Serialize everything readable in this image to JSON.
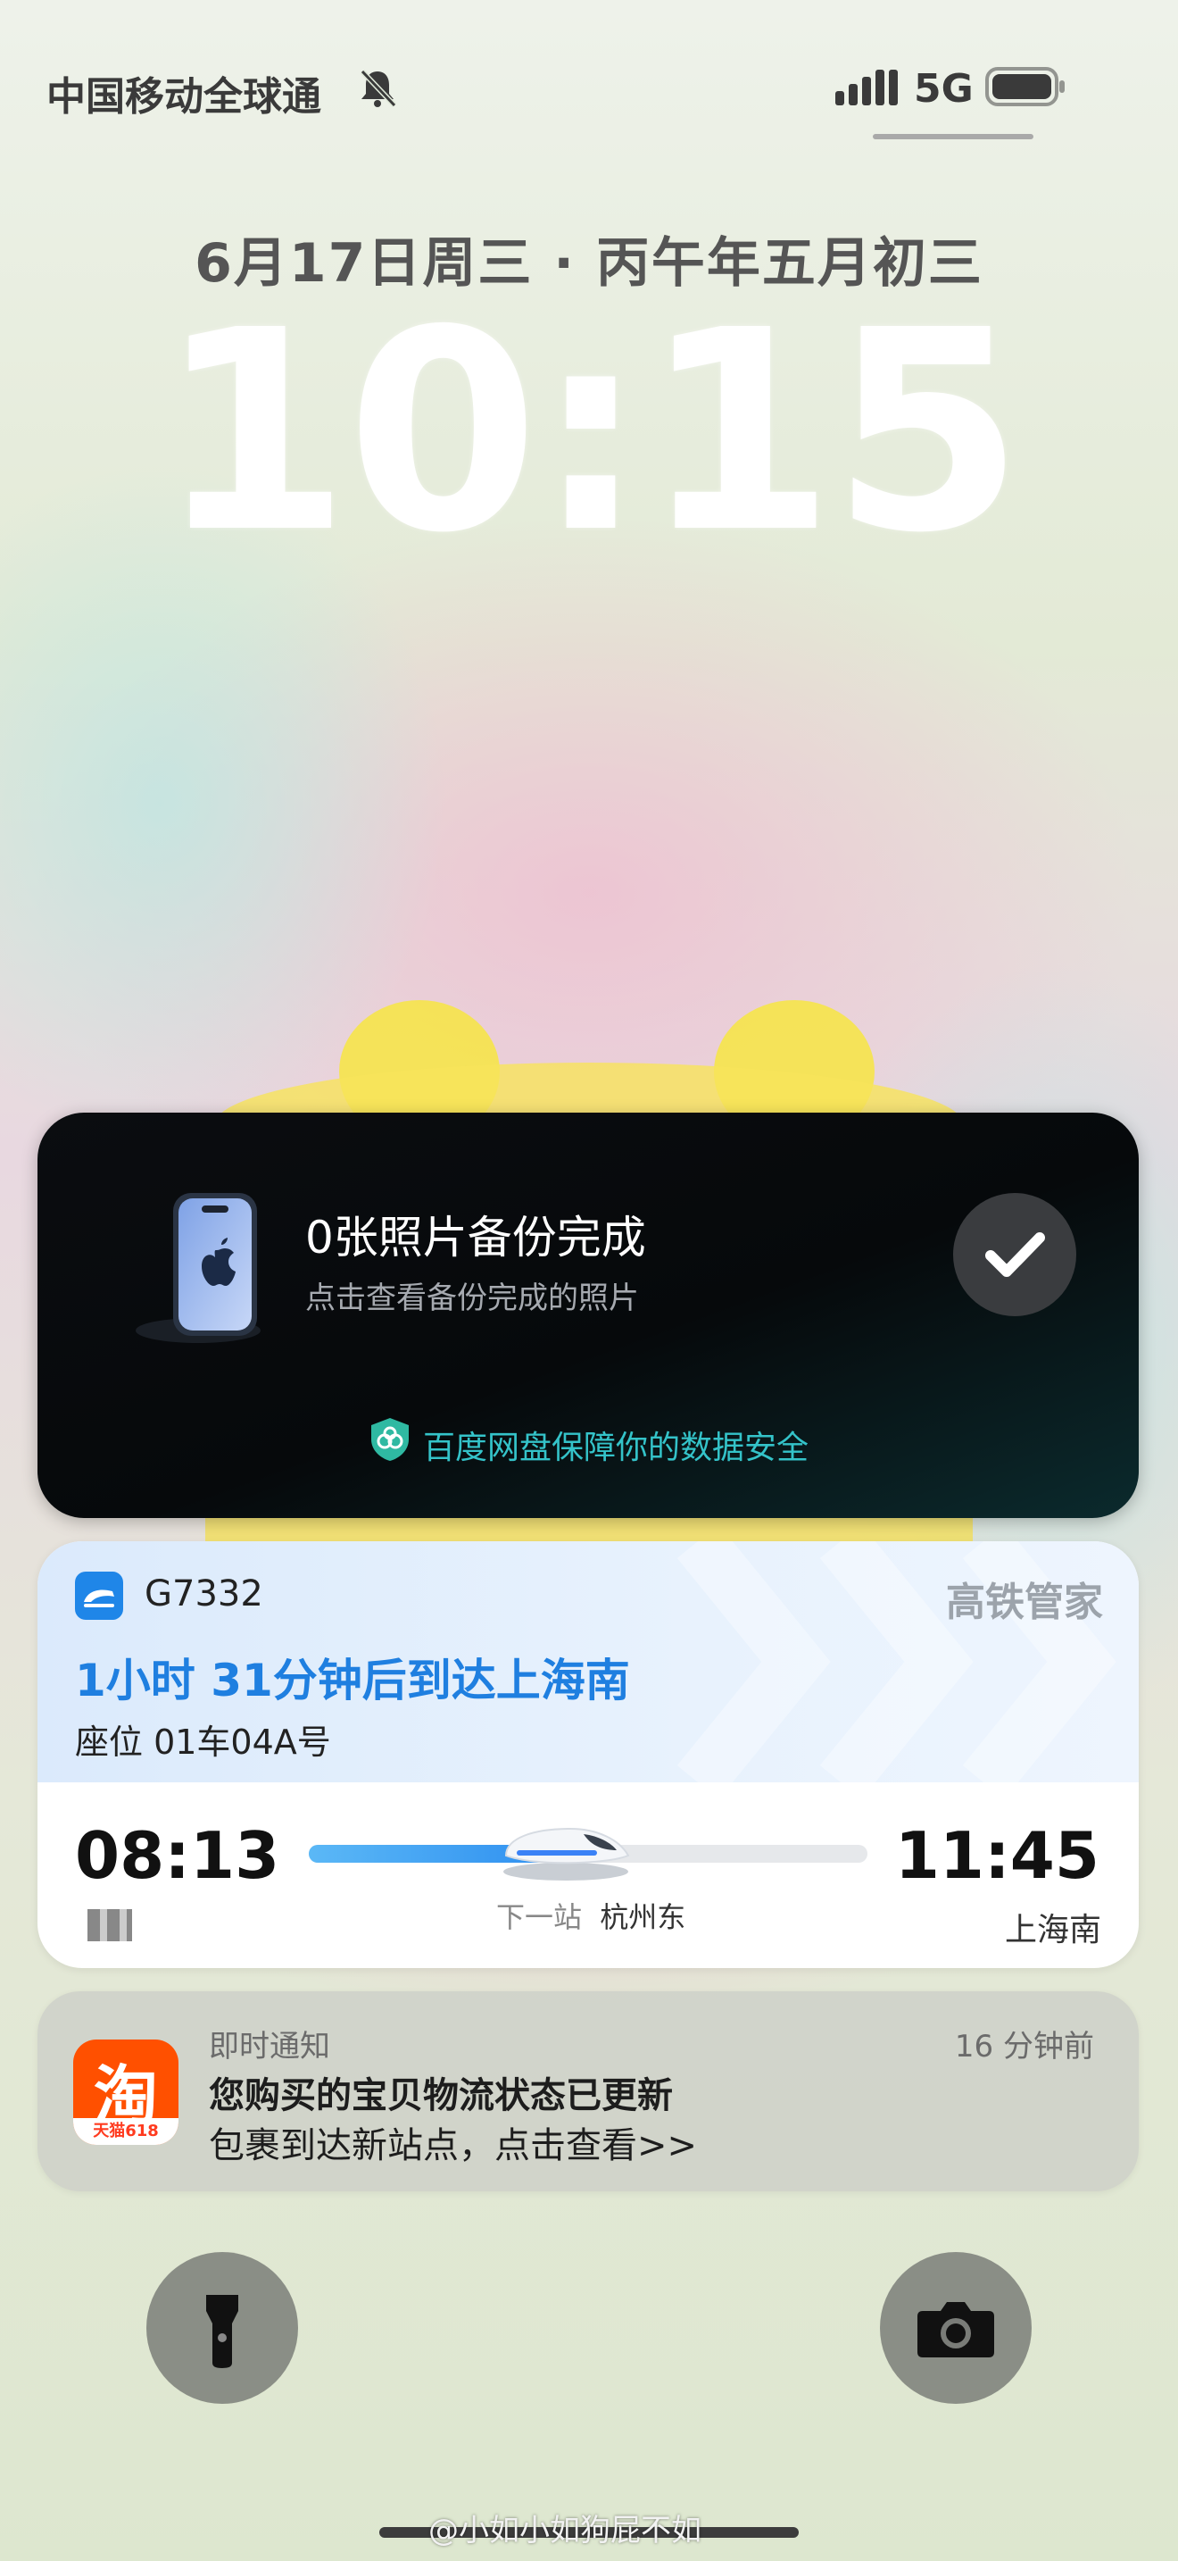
{
  "status_bar": {
    "carrier": "中国移动全球通",
    "network": "5G",
    "icons": [
      "bell-muted-icon",
      "signal-icon",
      "battery-icon"
    ]
  },
  "lock_screen": {
    "date": "6月17日周三 · 丙午年五月初三",
    "time": "10:15"
  },
  "notifications": {
    "baidu": {
      "title": "0张照片备份完成",
      "subtitle": "点击查看备份完成的照片",
      "footer": "百度网盘保障你的数据安全",
      "icons": [
        "phone-illustration-icon",
        "checkmark-icon",
        "shield-icon"
      ]
    },
    "train": {
      "train_number": "G7332",
      "brand": "高铁管家",
      "arrival_text": "1小时 31分钟后到达上海南",
      "seat": "座位 01车04A号",
      "depart_time": "08:13",
      "arrive_time": "11:45",
      "next_stop_label": "下一站",
      "next_stop": "杭州东",
      "destination": "上海南",
      "progress": 0.46,
      "accent_color": "#1f7fe0"
    },
    "taobao": {
      "app_label": "即时通知",
      "time": "16 分钟前",
      "title": "您购买的宝贝物流状态已更新",
      "body": "包裹到达新站点，点击查看>>",
      "icon_text": "淘",
      "icon_sub": "天猫618",
      "brand_color": "#ff5000"
    }
  },
  "bottom": {
    "left_icon": "flashlight-icon",
    "right_icon": "camera-icon",
    "watermark": "@小如小如狗屁不如"
  }
}
